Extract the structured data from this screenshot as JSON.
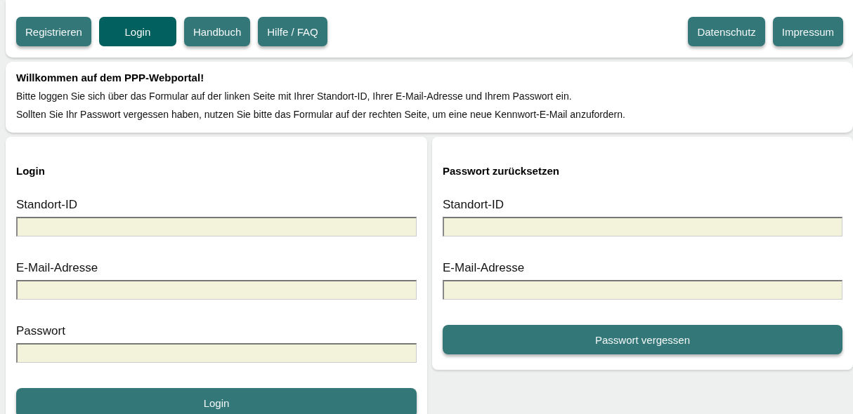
{
  "nav": {
    "left": [
      {
        "label": "Registrieren",
        "selected": false
      },
      {
        "label": "Login",
        "selected": true
      },
      {
        "label": "Handbuch",
        "selected": false
      },
      {
        "label": "Hilfe / FAQ",
        "selected": false
      }
    ],
    "right": [
      {
        "label": "Datenschutz",
        "selected": false
      },
      {
        "label": "Impressum",
        "selected": false
      }
    ]
  },
  "intro": {
    "title": "Willkommen auf dem PPP-Webportal!",
    "paragraphs": [
      "Bitte loggen Sie sich über das Formular auf der linken Seite mit Ihrer Standort-ID, Ihrer E-Mail-Adresse und Ihrem Passwort ein.",
      "Sollten Sie Ihr Passwort vergessen haben, nutzen Sie bitte das Formular auf der rechten Seite, um eine neue Kennwort-E-Mail anzufordern."
    ]
  },
  "forms": [
    {
      "title": "Login",
      "fields": [
        {
          "label": "Standort-ID"
        },
        {
          "label": "E-Mail-Adresse"
        },
        {
          "label": "Passwort"
        }
      ],
      "button": "Login"
    },
    {
      "title": "Passwort zurücksetzen",
      "fields": [
        {
          "label": "Standort-ID"
        },
        {
          "label": "E-Mail-Adresse"
        }
      ],
      "button": "Passwort vergessen"
    }
  ]
}
